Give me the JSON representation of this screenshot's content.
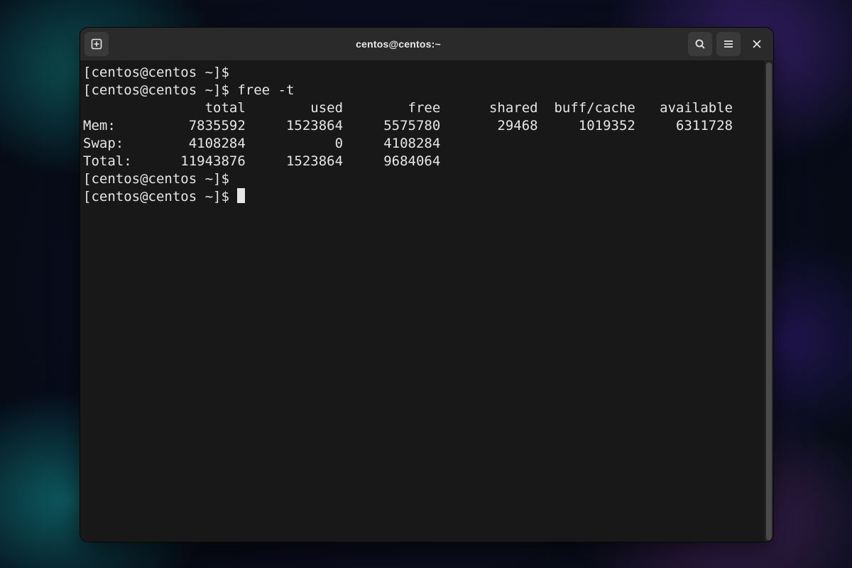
{
  "window": {
    "title": "centos@centos:~"
  },
  "icons": {
    "new_tab": "new-tab-icon",
    "search": "search-icon",
    "menu": "hamburger-menu-icon",
    "close": "close-icon"
  },
  "terminal": {
    "prompt": "[centos@centos ~]$ ",
    "lines": [
      "[centos@centos ~]$ ",
      "[centos@centos ~]$ free -t",
      "               total        used        free      shared  buff/cache   available",
      "Mem:         7835592     1523864     5575780       29468     1019352     6311728",
      "Swap:        4108284           0     4108284",
      "Total:      11943876     1523864     9684064",
      "[centos@centos ~]$ ",
      "[centos@centos ~]$ "
    ],
    "cursor_on_last": true,
    "command": "free -t",
    "table": {
      "headers": [
        "",
        "total",
        "used",
        "free",
        "shared",
        "buff/cache",
        "available"
      ],
      "rows": [
        {
          "label": "Mem:",
          "total": 7835592,
          "used": 1523864,
          "free": 5575780,
          "shared": 29468,
          "buff_cache": 1019352,
          "available": 6311728
        },
        {
          "label": "Swap:",
          "total": 4108284,
          "used": 0,
          "free": 4108284
        },
        {
          "label": "Total:",
          "total": 11943876,
          "used": 1523864,
          "free": 9684064
        }
      ]
    }
  },
  "colors": {
    "window_bg": "#1d1d1d",
    "terminal_bg": "#181818",
    "terminal_fg": "#e6e6e6",
    "titlebar_bg": "#2a2a2a",
    "button_bg": "#3a3a3a"
  }
}
